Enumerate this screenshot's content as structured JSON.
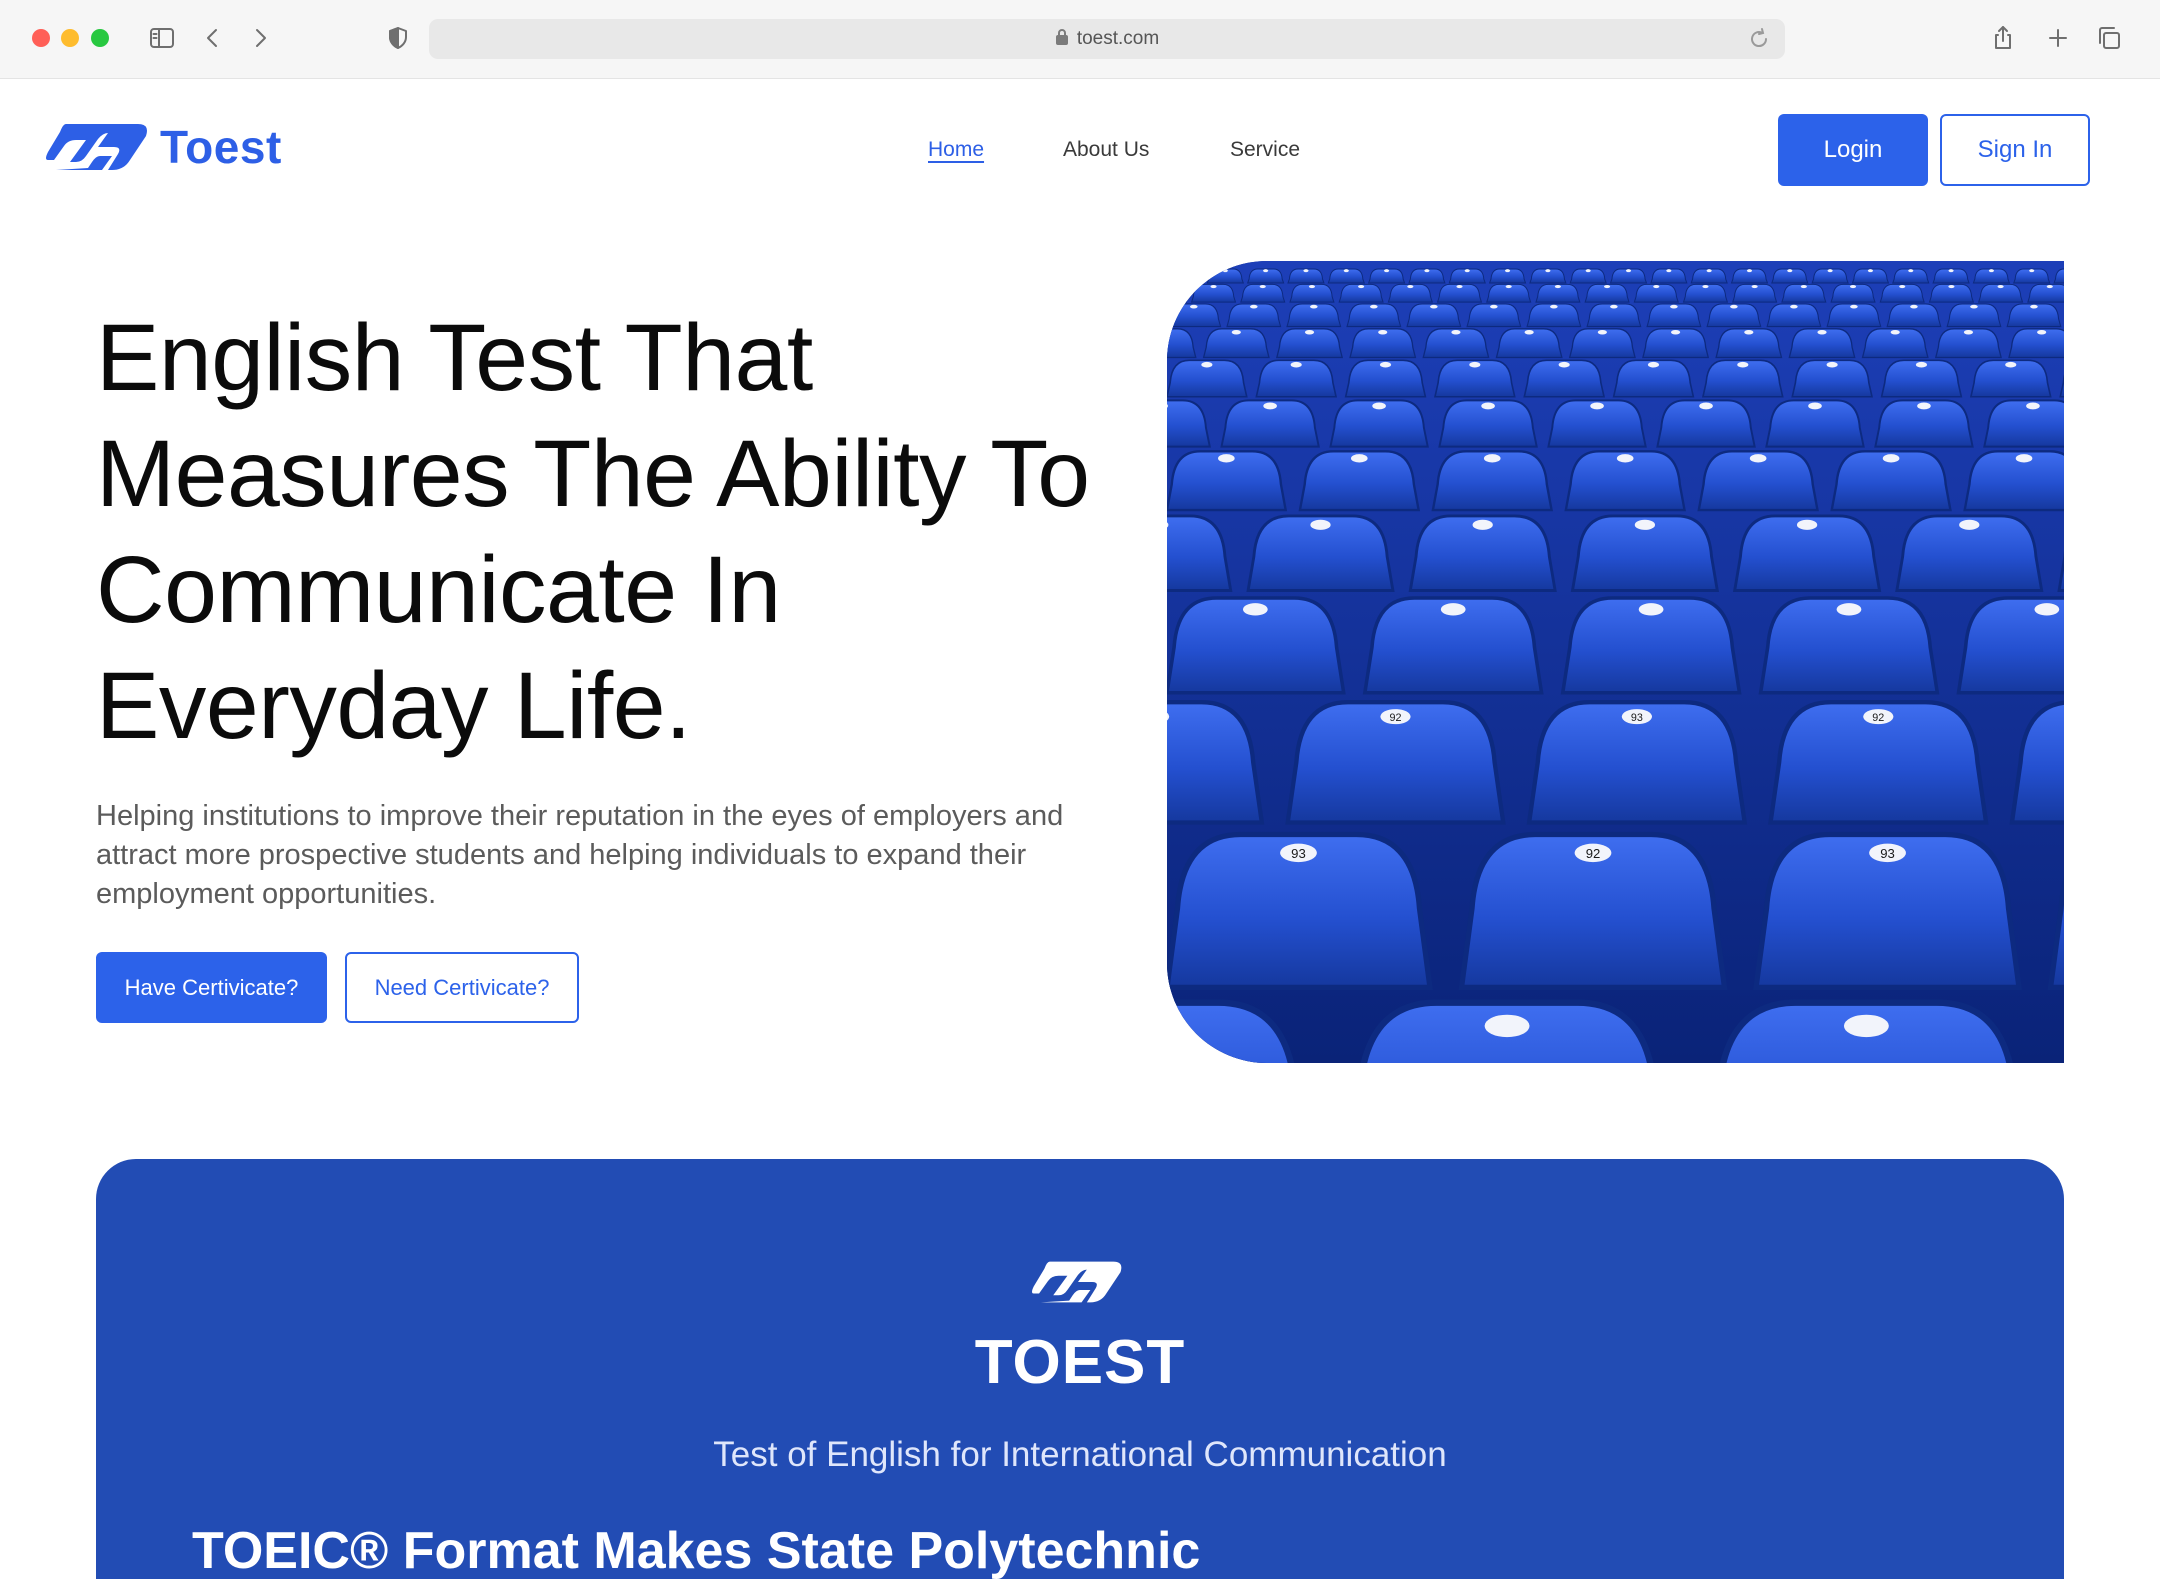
{
  "browser": {
    "url": "toest.com"
  },
  "header": {
    "brand": "Toest",
    "nav": [
      {
        "label": "Home",
        "active": true
      },
      {
        "label": "About Us",
        "active": false
      },
      {
        "label": "Service",
        "active": false
      }
    ],
    "login_label": "Login",
    "signin_label": "Sign In"
  },
  "hero": {
    "title_lines": [
      "English Test That",
      "Measures The Ability To",
      "Communicate In",
      "Everyday Life."
    ],
    "subtitle": "Helping institutions to improve their reputation in the eyes of employers and attract more prospective students and helping individuals to expand their employment opportunities.",
    "have_cert_label": "Have Certivicate?",
    "need_cert_label": "Need Certivicate?",
    "seat_numbers": [
      "92",
      "93",
      "92",
      "93",
      "92",
      "93"
    ]
  },
  "band": {
    "title": "TOEST",
    "subtitle": "Test of English for International Communication",
    "partial_heading": "TOEIC® Format Makes State Polytechnic"
  },
  "colors": {
    "brand_blue": "#2c62ea",
    "band_blue": "#224cb4",
    "seat_blue": "#2450d0"
  }
}
